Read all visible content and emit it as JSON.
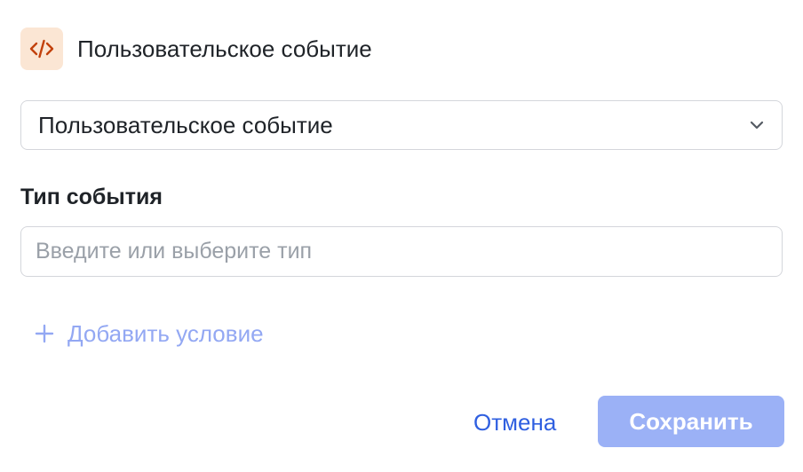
{
  "header": {
    "icon": "code-icon",
    "title": "Пользовательское событие"
  },
  "event_select": {
    "selected": "Пользовательское событие",
    "icon": "chevron-down-icon"
  },
  "event_type": {
    "label": "Тип события",
    "value": "",
    "placeholder": "Введите или выберите тип"
  },
  "add_condition": {
    "icon": "plus-icon",
    "label": "Добавить условие"
  },
  "footer": {
    "cancel_label": "Отмена",
    "save_label": "Сохранить"
  },
  "colors": {
    "accent": "#2f5fe0",
    "accent_disabled": "#9bb1f6",
    "icon_bg": "#fbe6d4",
    "icon_fg": "#c2410c"
  }
}
